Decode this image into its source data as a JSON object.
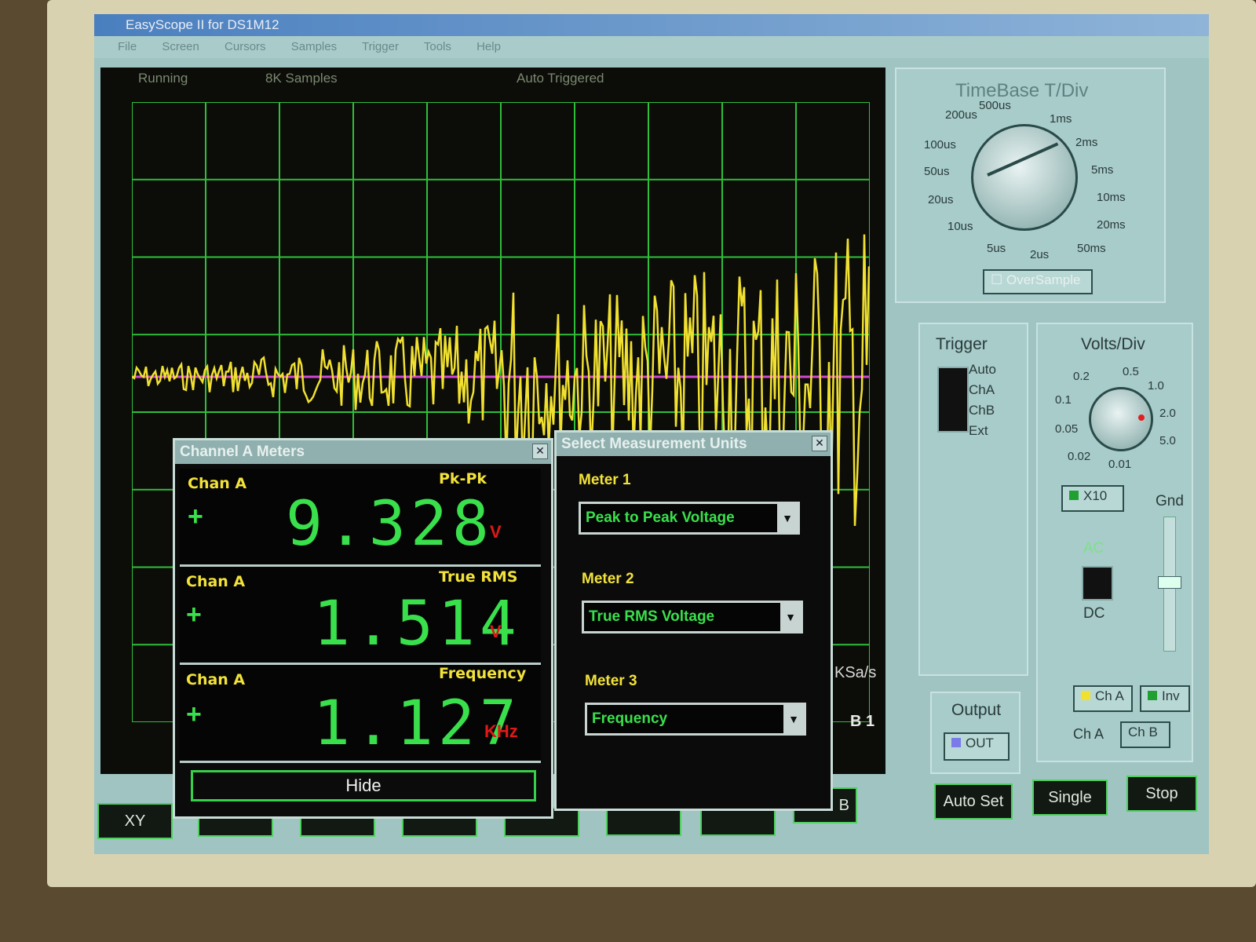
{
  "window": {
    "title": "EasyScope II for DS1M12"
  },
  "menu": [
    "File",
    "Screen",
    "Cursors",
    "Samples",
    "Trigger",
    "Tools",
    "Help"
  ],
  "scope_status": {
    "state": "Running",
    "samples": "8K Samples",
    "trigger": "Auto Triggered"
  },
  "timebase": {
    "title": "TimeBase T/Div",
    "labels": [
      "200us",
      "500us",
      "1ms",
      "2ms",
      "5ms",
      "10ms",
      "20ms",
      "50ms",
      "2us",
      "5us",
      "10us",
      "20us",
      "50us",
      "100us"
    ],
    "oversample": "OverSample"
  },
  "trigger": {
    "title": "Trigger",
    "options": [
      "Auto",
      "ChA",
      "ChB",
      "Ext"
    ]
  },
  "volts": {
    "title": "Volts/Div",
    "labels": [
      "0.2",
      "0.5",
      "1.0",
      "2.0",
      "5.0",
      "0.01",
      "0.02",
      "0.05",
      "0.1"
    ],
    "x10": "X10",
    "gnd": "Gnd",
    "ac": "AC",
    "dc": "DC"
  },
  "output": {
    "title": "Output",
    "out": "OUT"
  },
  "channel": {
    "cha_btn": "Ch A",
    "inv_btn": "Inv",
    "cha_tab": "Ch A",
    "chb_tab": "Ch B"
  },
  "bottom_buttons": {
    "autoset": "Auto Set",
    "single": "Single",
    "stop": "Stop",
    "xy": "XY"
  },
  "readouts": {
    "rate_fragment": "KSa/s",
    "b1": "B 1",
    "b": "B"
  },
  "meters_dialog": {
    "title": "Channel A Meters",
    "rows": [
      {
        "channel": "Chan A",
        "kind": "Pk-Pk",
        "sign": "+",
        "value": "9.328",
        "unit": "V"
      },
      {
        "channel": "Chan A",
        "kind": "True RMS",
        "sign": "+",
        "value": "1.514",
        "unit": "V"
      },
      {
        "channel": "Chan A",
        "kind": "Frequency",
        "sign": "+",
        "value": "1.127",
        "unit": "KHz"
      }
    ],
    "hide": "Hide"
  },
  "units_dialog": {
    "title": "Select Measurement Units",
    "meters": [
      {
        "label": "Meter 1",
        "value": "Peak to Peak Voltage"
      },
      {
        "label": "Meter 2",
        "value": "True RMS Voltage"
      },
      {
        "label": "Meter 3",
        "value": "Frequency"
      }
    ]
  },
  "colors": {
    "trace": "#f0e030",
    "grid": "#2fbf3a",
    "ref_line": "#d04ad0",
    "digits": "#39e04c"
  }
}
